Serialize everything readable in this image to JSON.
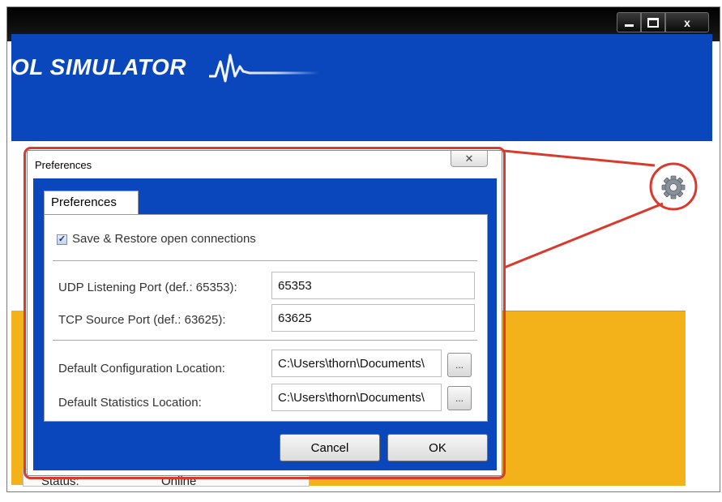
{
  "app": {
    "banner_title": "OL SIMULATOR",
    "status_label": "Status:",
    "status_value": "Online"
  },
  "window_controls": {
    "close_glyph": "x"
  },
  "dialog": {
    "title": "Preferences",
    "close_glyph": "✕",
    "tab_label": "Preferences",
    "save_restore": {
      "label": "Save & Restore open connections",
      "checked": true
    },
    "udp_port": {
      "label": "UDP Listening Port (def.: 65353):",
      "value": "65353"
    },
    "tcp_port": {
      "label": "TCP Source Port (def.: 63625):",
      "value": "63625"
    },
    "config_location": {
      "label": "Default Configuration Location:",
      "value": "C:\\Users\\thorn\\Documents\\",
      "browse_label": "..."
    },
    "stats_location": {
      "label": "Default Statistics Location:",
      "value": "C:\\Users\\thorn\\Documents\\",
      "browse_label": "..."
    },
    "cancel_label": "Cancel",
    "ok_label": "OK"
  },
  "colors": {
    "banner_blue": "#0a47bd",
    "highlight_red": "#d83a2b",
    "panel_orange": "#f3b11a"
  },
  "icons": [
    "minimize-icon",
    "maximize-icon",
    "close-icon",
    "gear-icon",
    "heartbeat-wave-logo",
    "check-icon"
  ]
}
